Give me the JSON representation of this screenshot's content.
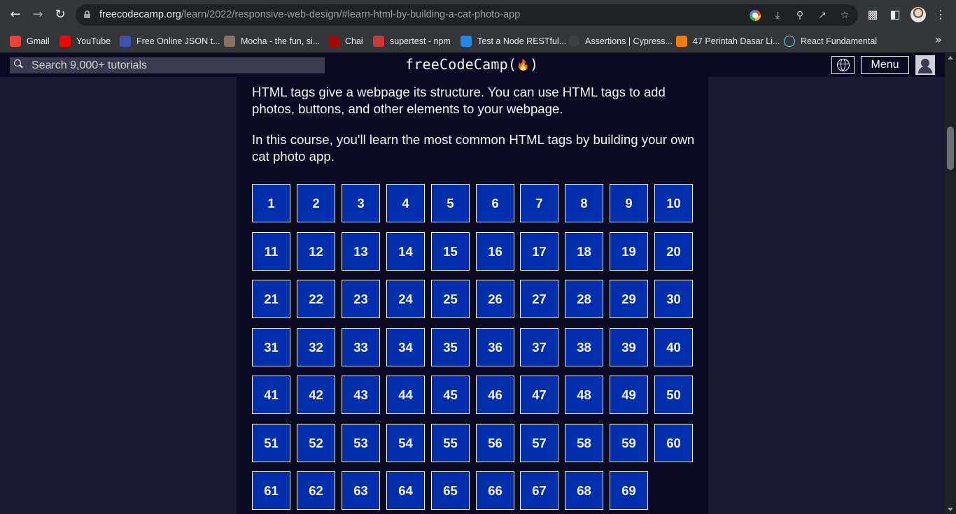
{
  "browser": {
    "url_host": "freecodecamp.org",
    "url_path": "/learn/2022/responsive-web-design/#learn-html-by-building-a-cat-photo-app",
    "bookmarks": [
      {
        "label": "Gmail",
        "icon": "gmail-icon",
        "color": "#ea4335"
      },
      {
        "label": "YouTube",
        "icon": "youtube-icon",
        "color": "#ff0000"
      },
      {
        "label": "Free Online JSON t...",
        "icon": "json-tool-icon",
        "color": "#3f51b5"
      },
      {
        "label": "Mocha - the fun, si...",
        "icon": "mocha-icon",
        "color": "#8d6e63"
      },
      {
        "label": "Chai",
        "icon": "chai-icon",
        "color": "#a30701"
      },
      {
        "label": "supertest - npm",
        "icon": "npm-icon",
        "color": "#cb3837"
      },
      {
        "label": "Test a Node RESTful...",
        "icon": "test-icon",
        "color": "#1e88e5"
      },
      {
        "label": "Assertions | Cypress...",
        "icon": "cypress-icon",
        "color": "#3c4043"
      },
      {
        "label": "47 Perintah Dasar Li...",
        "icon": "article-icon",
        "color": "#f57c00"
      },
      {
        "label": "React Fundamental",
        "icon": "react-icon",
        "color": "#61dafb"
      }
    ]
  },
  "navbar": {
    "search_placeholder": "Search 9,000+ tutorials",
    "logo_text": "freeCodeCamp(",
    "logo_close": ")",
    "menu_label": "Menu"
  },
  "intro": {
    "p1": "HTML tags give a webpage its structure. You can use HTML tags to add photos, buttons, and other elements to your webpage.",
    "p2": "In this course, you'll learn the most common HTML tags by building your own cat photo app."
  },
  "steps": [
    "1",
    "2",
    "3",
    "4",
    "5",
    "6",
    "7",
    "8",
    "9",
    "10",
    "11",
    "12",
    "13",
    "14",
    "15",
    "16",
    "17",
    "18",
    "19",
    "20",
    "21",
    "22",
    "23",
    "24",
    "25",
    "26",
    "27",
    "28",
    "29",
    "30",
    "31",
    "32",
    "33",
    "34",
    "35",
    "36",
    "37",
    "38",
    "39",
    "40",
    "41",
    "42",
    "43",
    "44",
    "45",
    "46",
    "47",
    "48",
    "49",
    "50",
    "51",
    "52",
    "53",
    "54",
    "55",
    "56",
    "57",
    "58",
    "59",
    "60",
    "61",
    "62",
    "63",
    "64",
    "65",
    "66",
    "67",
    "68",
    "69"
  ],
  "colors": {
    "step_bg": "#002ead",
    "panel_bg": "#0a0a23",
    "page_bg": "#1b1b32"
  }
}
